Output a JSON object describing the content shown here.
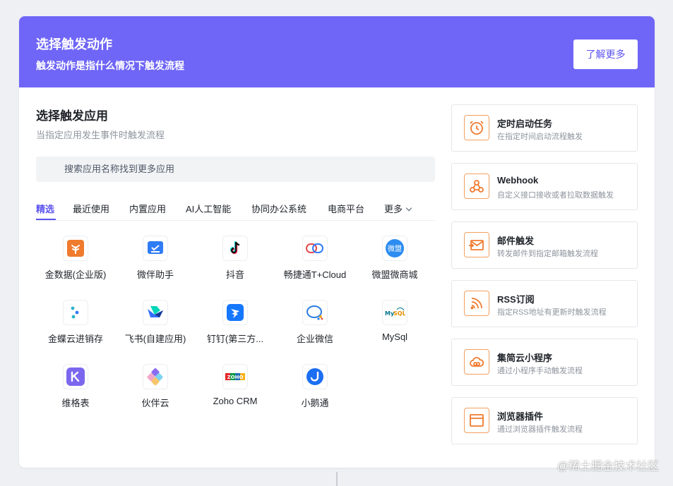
{
  "header": {
    "title": "选择触发动作",
    "subtitle": "触发动作是指什么情况下触发流程",
    "learn_more": "了解更多"
  },
  "apps_section": {
    "title": "选择触发应用",
    "desc": "当指定应用发生事件时触发流程",
    "search_placeholder": "搜索应用名称找到更多应用",
    "tabs": [
      "精选",
      "最近使用",
      "内置应用",
      "AI人工智能",
      "协同办公系统",
      "电商平台",
      "更多"
    ],
    "active_tab": "精选",
    "apps": [
      {
        "name": "金数据(企业版)",
        "icon": "jinshuju-icon",
        "color": "#f07a2e"
      },
      {
        "name": "微伴助手",
        "icon": "weiban-icon",
        "color": "#2f7cf6"
      },
      {
        "name": "抖音",
        "icon": "douyin-icon",
        "color": "#111111"
      },
      {
        "name": "畅捷通T+Cloud",
        "icon": "chanjet-icon",
        "color": "#e5484d"
      },
      {
        "name": "微盟微商城",
        "icon": "weimob-icon",
        "color": "#2d8cf0"
      },
      {
        "name": "金蝶云进销存",
        "icon": "kingdee-icon",
        "color": "#2ab3c9"
      },
      {
        "name": "飞书(自建应用)",
        "icon": "feishu-icon",
        "color": "#3370ff"
      },
      {
        "name": "钉钉(第三方...",
        "icon": "dingtalk-icon",
        "color": "#1677ff"
      },
      {
        "name": "企业微信",
        "icon": "wecom-icon",
        "color": "#2a7de1"
      },
      {
        "name": "MySql",
        "icon": "mysql-icon",
        "color": "#e48e00"
      },
      {
        "name": "维格表",
        "icon": "vika-icon",
        "color": "#7b67ee"
      },
      {
        "name": "伙伴云",
        "icon": "huoban-icon",
        "color": "#8a6cf0"
      },
      {
        "name": "Zoho CRM",
        "icon": "zoho-icon",
        "color": "#e42527"
      },
      {
        "name": "小鹅通",
        "icon": "xiaoe-icon",
        "color": "#1c6ef2"
      }
    ]
  },
  "triggers": [
    {
      "title": "定时启动任务",
      "desc": "在指定时间启动流程触发",
      "icon": "alarm-clock-icon"
    },
    {
      "title": "Webhook",
      "desc": "自定义接口接收或者拉取数据触发",
      "icon": "webhook-icon"
    },
    {
      "title": "邮件触发",
      "desc": "转发邮件到指定邮箱触发流程",
      "icon": "mail-icon"
    },
    {
      "title": "RSS订阅",
      "desc": "指定RSS地址有更新时触发流程",
      "icon": "rss-icon"
    },
    {
      "title": "集简云小程序",
      "desc": "通过小程序手动触发流程",
      "icon": "cloud-icon"
    },
    {
      "title": "浏览器插件",
      "desc": "通过浏览器插件触发流程",
      "icon": "browser-icon"
    }
  ],
  "colors": {
    "accent": "#6f66f7",
    "trigger_icon": "#f07a2e"
  },
  "watermark": "@稀土掘金技术社区"
}
